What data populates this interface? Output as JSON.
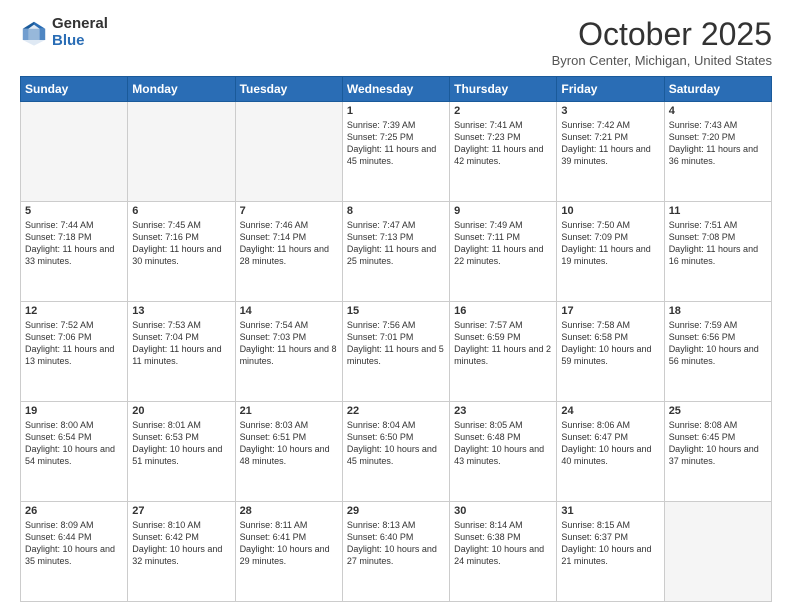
{
  "logo": {
    "general": "General",
    "blue": "Blue"
  },
  "header": {
    "title": "October 2025",
    "subtitle": "Byron Center, Michigan, United States"
  },
  "weekdays": [
    "Sunday",
    "Monday",
    "Tuesday",
    "Wednesday",
    "Thursday",
    "Friday",
    "Saturday"
  ],
  "weeks": [
    [
      {
        "day": "",
        "info": ""
      },
      {
        "day": "",
        "info": ""
      },
      {
        "day": "",
        "info": ""
      },
      {
        "day": "1",
        "info": "Sunrise: 7:39 AM\nSunset: 7:25 PM\nDaylight: 11 hours\nand 45 minutes."
      },
      {
        "day": "2",
        "info": "Sunrise: 7:41 AM\nSunset: 7:23 PM\nDaylight: 11 hours\nand 42 minutes."
      },
      {
        "day": "3",
        "info": "Sunrise: 7:42 AM\nSunset: 7:21 PM\nDaylight: 11 hours\nand 39 minutes."
      },
      {
        "day": "4",
        "info": "Sunrise: 7:43 AM\nSunset: 7:20 PM\nDaylight: 11 hours\nand 36 minutes."
      }
    ],
    [
      {
        "day": "5",
        "info": "Sunrise: 7:44 AM\nSunset: 7:18 PM\nDaylight: 11 hours\nand 33 minutes."
      },
      {
        "day": "6",
        "info": "Sunrise: 7:45 AM\nSunset: 7:16 PM\nDaylight: 11 hours\nand 30 minutes."
      },
      {
        "day": "7",
        "info": "Sunrise: 7:46 AM\nSunset: 7:14 PM\nDaylight: 11 hours\nand 28 minutes."
      },
      {
        "day": "8",
        "info": "Sunrise: 7:47 AM\nSunset: 7:13 PM\nDaylight: 11 hours\nand 25 minutes."
      },
      {
        "day": "9",
        "info": "Sunrise: 7:49 AM\nSunset: 7:11 PM\nDaylight: 11 hours\nand 22 minutes."
      },
      {
        "day": "10",
        "info": "Sunrise: 7:50 AM\nSunset: 7:09 PM\nDaylight: 11 hours\nand 19 minutes."
      },
      {
        "day": "11",
        "info": "Sunrise: 7:51 AM\nSunset: 7:08 PM\nDaylight: 11 hours\nand 16 minutes."
      }
    ],
    [
      {
        "day": "12",
        "info": "Sunrise: 7:52 AM\nSunset: 7:06 PM\nDaylight: 11 hours\nand 13 minutes."
      },
      {
        "day": "13",
        "info": "Sunrise: 7:53 AM\nSunset: 7:04 PM\nDaylight: 11 hours\nand 11 minutes."
      },
      {
        "day": "14",
        "info": "Sunrise: 7:54 AM\nSunset: 7:03 PM\nDaylight: 11 hours\nand 8 minutes."
      },
      {
        "day": "15",
        "info": "Sunrise: 7:56 AM\nSunset: 7:01 PM\nDaylight: 11 hours\nand 5 minutes."
      },
      {
        "day": "16",
        "info": "Sunrise: 7:57 AM\nSunset: 6:59 PM\nDaylight: 11 hours\nand 2 minutes."
      },
      {
        "day": "17",
        "info": "Sunrise: 7:58 AM\nSunset: 6:58 PM\nDaylight: 10 hours\nand 59 minutes."
      },
      {
        "day": "18",
        "info": "Sunrise: 7:59 AM\nSunset: 6:56 PM\nDaylight: 10 hours\nand 56 minutes."
      }
    ],
    [
      {
        "day": "19",
        "info": "Sunrise: 8:00 AM\nSunset: 6:54 PM\nDaylight: 10 hours\nand 54 minutes."
      },
      {
        "day": "20",
        "info": "Sunrise: 8:01 AM\nSunset: 6:53 PM\nDaylight: 10 hours\nand 51 minutes."
      },
      {
        "day": "21",
        "info": "Sunrise: 8:03 AM\nSunset: 6:51 PM\nDaylight: 10 hours\nand 48 minutes."
      },
      {
        "day": "22",
        "info": "Sunrise: 8:04 AM\nSunset: 6:50 PM\nDaylight: 10 hours\nand 45 minutes."
      },
      {
        "day": "23",
        "info": "Sunrise: 8:05 AM\nSunset: 6:48 PM\nDaylight: 10 hours\nand 43 minutes."
      },
      {
        "day": "24",
        "info": "Sunrise: 8:06 AM\nSunset: 6:47 PM\nDaylight: 10 hours\nand 40 minutes."
      },
      {
        "day": "25",
        "info": "Sunrise: 8:08 AM\nSunset: 6:45 PM\nDaylight: 10 hours\nand 37 minutes."
      }
    ],
    [
      {
        "day": "26",
        "info": "Sunrise: 8:09 AM\nSunset: 6:44 PM\nDaylight: 10 hours\nand 35 minutes."
      },
      {
        "day": "27",
        "info": "Sunrise: 8:10 AM\nSunset: 6:42 PM\nDaylight: 10 hours\nand 32 minutes."
      },
      {
        "day": "28",
        "info": "Sunrise: 8:11 AM\nSunset: 6:41 PM\nDaylight: 10 hours\nand 29 minutes."
      },
      {
        "day": "29",
        "info": "Sunrise: 8:13 AM\nSunset: 6:40 PM\nDaylight: 10 hours\nand 27 minutes."
      },
      {
        "day": "30",
        "info": "Sunrise: 8:14 AM\nSunset: 6:38 PM\nDaylight: 10 hours\nand 24 minutes."
      },
      {
        "day": "31",
        "info": "Sunrise: 8:15 AM\nSunset: 6:37 PM\nDaylight: 10 hours\nand 21 minutes."
      },
      {
        "day": "",
        "info": ""
      }
    ]
  ]
}
